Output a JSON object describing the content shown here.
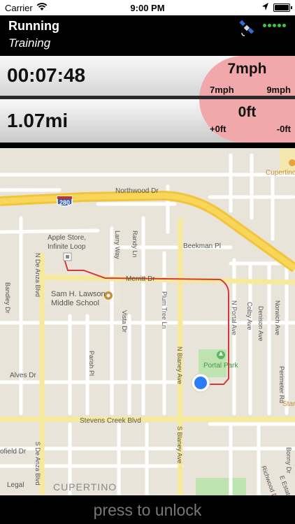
{
  "status_bar": {
    "carrier": "Carrier",
    "time": "9:00 PM"
  },
  "header": {
    "title": "Running",
    "subtitle": "Training"
  },
  "stats": {
    "elapsed": "00:07:48",
    "distance": "1.07mi",
    "pace": {
      "current": "7mph",
      "left": "7mph",
      "right": "9mph"
    },
    "elevation": {
      "current": "0ft",
      "left": "+0ft",
      "right": "-0ft"
    }
  },
  "map": {
    "highway_shield": "280",
    "labels": {
      "northwood": "Northwood Dr",
      "apple_store_1": "Apple Store,",
      "apple_store_2": "Infinite Loop",
      "larry_way": "Larry Way",
      "randy_ln": "Randy Ln",
      "beekman": "Beekman Pl",
      "merritt": "Merritt Dr",
      "sam_lawson_1": "Sam H. Lawson",
      "sam_lawson_2": "Middle School",
      "vista": "Vista Dr",
      "plum_tree": "Plum Tree Ln",
      "n_portal": "N Portal Ave",
      "colby": "Colby Ave",
      "denison": "Denison Ave",
      "norwich": "Norwich Ave",
      "de_anza_n": "N De Anza Blvd",
      "de_anza_s": "S De Anza Blvd",
      "bandley": "Bandley Dr",
      "parish": "Parish Pl",
      "alves": "Alves Dr",
      "n_blaney": "N Blaney Ave",
      "s_blaney": "S Blaney Ave",
      "portal_park": "Portal Park",
      "perimeter": "Perimeter Rd",
      "stevens_creek": "Stevens Creek Blvd",
      "cupertino_top": "Cupertino",
      "star": "Star",
      "ofield": "ofield Dr",
      "cupertino": "CUPERTINO",
      "legal": "Legal",
      "richwood": "Richwood Dr",
      "e_estates": "E Estates Dr",
      "bonny": "Bonny Dr"
    }
  },
  "unlock": {
    "label": "press to unlock"
  }
}
